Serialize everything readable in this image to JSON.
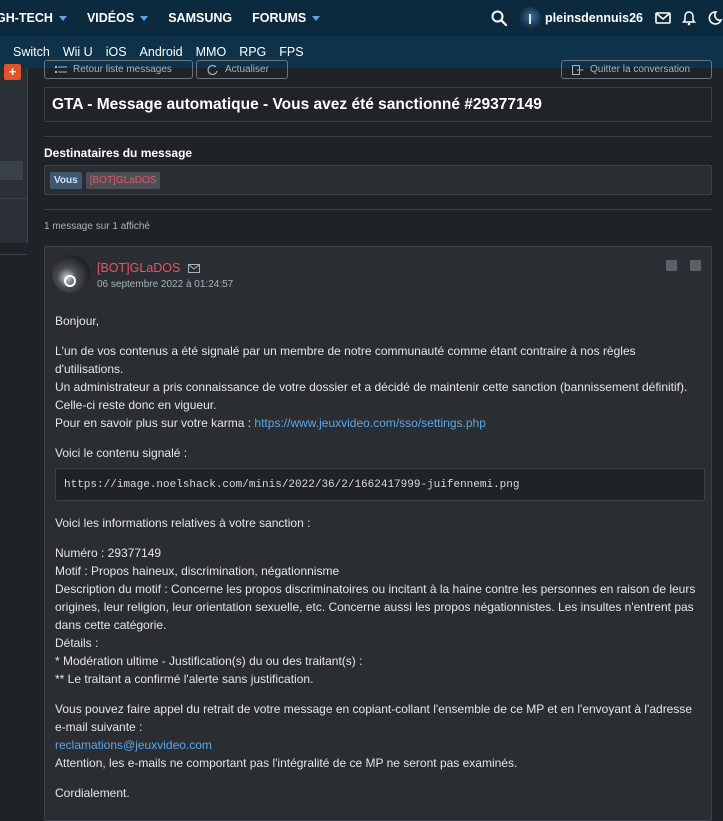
{
  "topnav": {
    "items": [
      {
        "label": "GH-TECH",
        "caret": true
      },
      {
        "label": "VIDÉOS",
        "caret": true
      },
      {
        "label": "SAMSUNG",
        "caret": false
      },
      {
        "label": "FORUMS",
        "caret": true
      }
    ],
    "username": "pleinsdennuis26"
  },
  "subnav": {
    "items": [
      "Switch",
      "Wii U",
      "iOS",
      "Android",
      "MMO",
      "RPG",
      "FPS"
    ]
  },
  "sidebar": {
    "plus_label": "+"
  },
  "toolbar": {
    "back_label": "Retour liste messages",
    "refresh_label": "Actualiser",
    "quit_label": "Quitter la conversation"
  },
  "conversation": {
    "title": "GTA - Message automatique - Vous avez été sanctionné #29377149",
    "recipients_label": "Destinataires du message",
    "recipients": [
      "Vous",
      "[BOT]GLaDOS"
    ],
    "count_text": "1 message sur 1 affiché"
  },
  "post": {
    "author": "[BOT]GLaDOS",
    "date": "06 septembre 2022 à 01:24:57",
    "greeting": "Bonjour,",
    "p1_l1": "L'un de vos contenus a été signalé par un membre de notre communauté comme étant contraire à nos règles d'utilisations.",
    "p1_l2": "Un administrateur a pris connaissance de votre dossier et a décidé de maintenir cette sanction (bannissement définitif). Celle-ci reste donc en vigueur.",
    "p1_l3_prefix": "Pour en savoir plus sur votre karma : ",
    "karma_link": "https://www.jeuxvideo.com/sso/settings.php",
    "reported_label": "Voici le contenu signalé :",
    "reported_code": "https://image.noelshack.com/minis/2022/36/2/1662417999-juifennemi.png",
    "sanction_label": "Voici les informations relatives à votre sanction :",
    "numero": "Numéro : 29377149",
    "motif": "Motif : Propos haineux, discrimination, négationnisme",
    "description": "Description du motif : Concerne les propos discriminatoires ou incitant à la haine contre les personnes en raison de leurs origines, leur religion, leur orientation sexuelle, etc. Concerne aussi les propos négationnistes. Les insultes n'entrent pas dans cette catégorie.",
    "details": "Détails :",
    "detail1": "* Modération ultime - Justification(s) du ou des traitant(s) :",
    "detail2": "** Le traitant a confirmé l'alerte sans justification.",
    "appeal": "Vous pouvez faire appel du retrait de votre message en copiant-collant l'ensemble de ce MP et en l'envoyant à l'adresse e-mail suivante :",
    "email_link": "reclamations@jeuxvideo.com",
    "warning": "Attention, les e-mails ne comportant pas l'intégralité de ce MP ne seront pas examinés.",
    "closing": "Cordialement."
  },
  "colors": {
    "topbar": "#0b2a3d",
    "subbar": "#0e3249",
    "link": "#5aa6e8",
    "bot_name": "#e8556a",
    "accent": "#e3532b"
  }
}
